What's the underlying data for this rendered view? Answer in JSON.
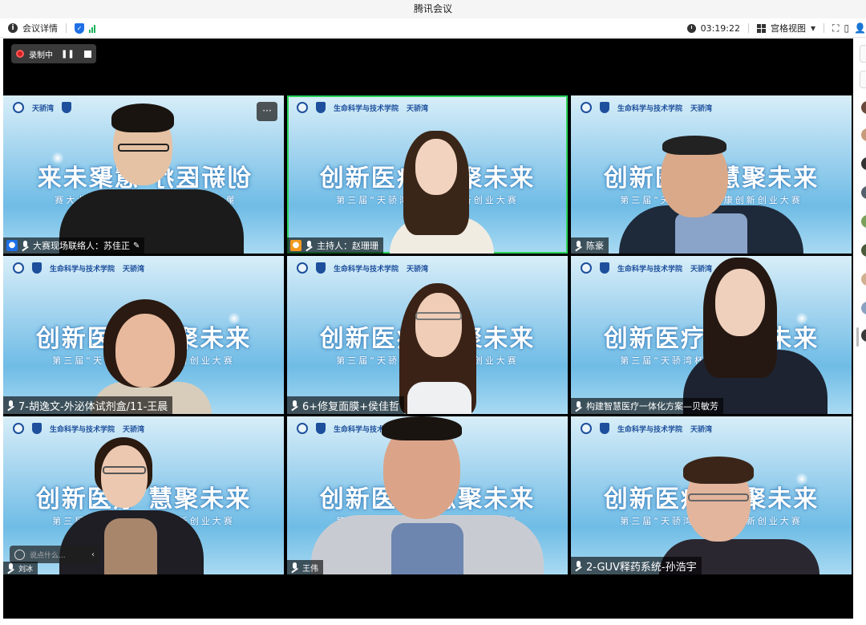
{
  "window": {
    "title": "腾讯会议"
  },
  "toolbar": {
    "meeting_info_label": "会议详情",
    "timer": "03:19:22",
    "view_label": "宫格视图"
  },
  "recording": {
    "label": "录制中"
  },
  "chat": {
    "placeholder": "说点什么..."
  },
  "banner": {
    "school_name": "生命科学与技术学院",
    "tianjiao": "天骄湾",
    "title": "创新医疗 慧聚未来",
    "subtitle": "第三届“天骄湾杯”健康创新创业大赛"
  },
  "tiles": [
    {
      "label": "大赛现场联络人：苏佳正"
    },
    {
      "label": "主持人：赵珊珊"
    },
    {
      "label": "陈豪"
    },
    {
      "label": "7-胡逸文-外泌体试剂盒/11-王晨"
    },
    {
      "label": "6+修复面膜+侯佳哲"
    },
    {
      "label": "构建智慧医疗一体化方案—贝敏芳"
    },
    {
      "label": "刘冰"
    },
    {
      "label": "王伟"
    },
    {
      "label": "2-GUV释药系统-孙浩宇"
    }
  ],
  "colors": {
    "active_speaker": "#2bd45a",
    "host_badge": "#f39a1e",
    "user_badge": "#1e6fe6",
    "recording": "#d41f1f"
  }
}
